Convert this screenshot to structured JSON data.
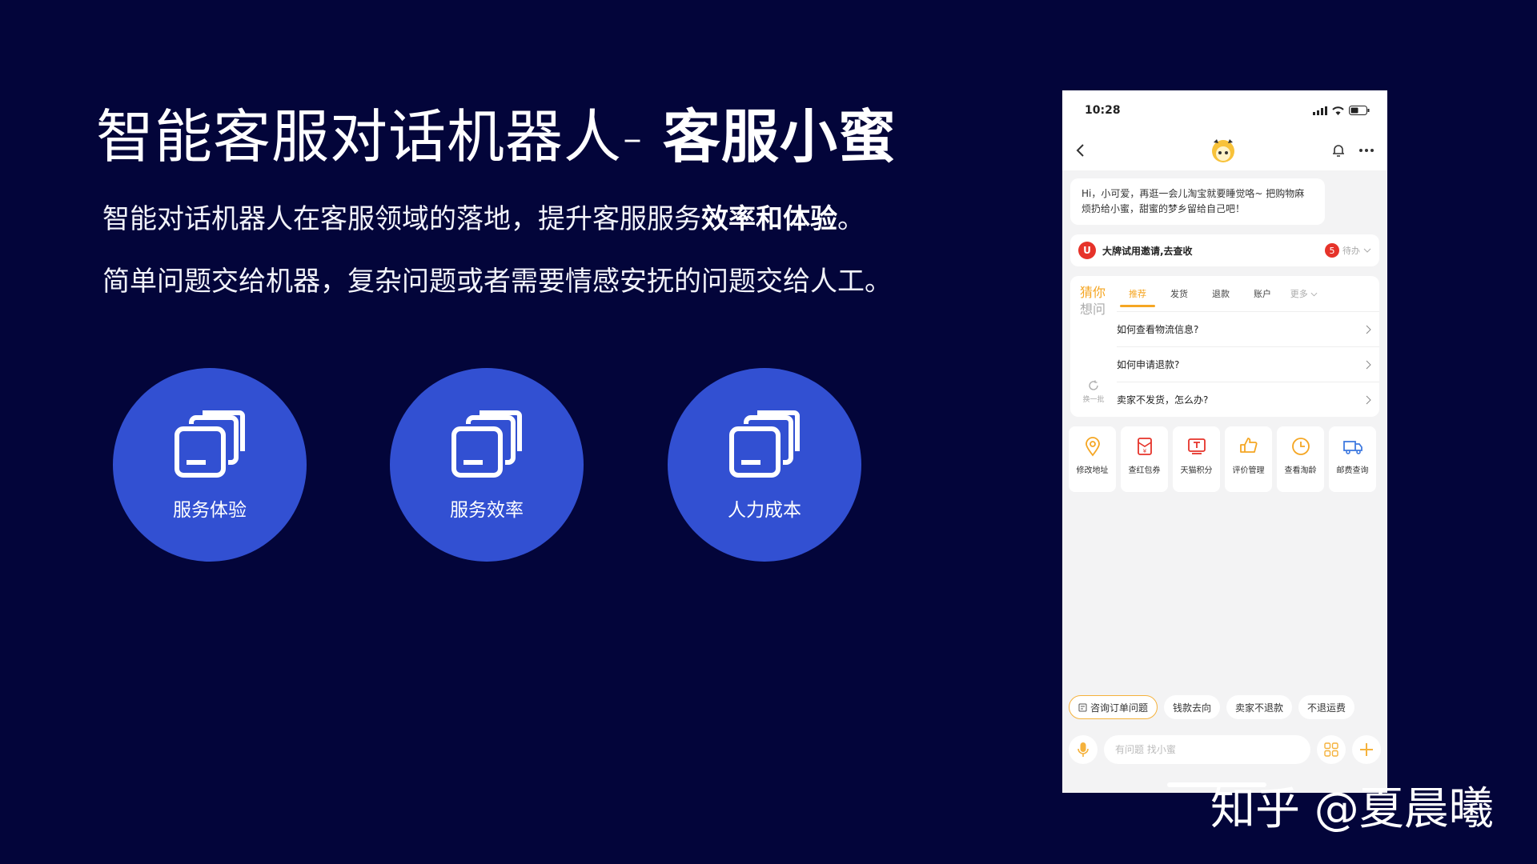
{
  "slide": {
    "title_light": "智能客服对话机器人- ",
    "title_bold": "客服小蜜",
    "line1_pre": "智能对话机器人在客服领域的落地，提升客服服务",
    "line1_bold": "效率和体验",
    "line1_post": "。",
    "line2": "简单问题交给机器，复杂问题或者需要情感安抚的问题交给人工。"
  },
  "circles": [
    {
      "label": "服务体验",
      "icon": "layers-icon"
    },
    {
      "label": "服务效率",
      "icon": "layers-icon"
    },
    {
      "label": "人力成本",
      "icon": "layers-icon"
    }
  ],
  "watermark": "知乎 @夏晨曦",
  "phone": {
    "time": "10:28",
    "greeting": "Hi，小可爱，再逛一会儿淘宝就要睡觉咯~ 把购物麻烦扔给小蜜，甜蜜的梦乡留给自己吧！",
    "invite": {
      "badge": "U",
      "text": "大牌试用邀请,去查收",
      "count": "5",
      "todo": "待办"
    },
    "guess": {
      "line1": "猜你",
      "line2": "想问",
      "refresh": "换一批"
    },
    "tabs": [
      "推荐",
      "发货",
      "退款",
      "账户",
      "更多"
    ],
    "questions": [
      "如何查看物流信息?",
      "如何申请退款?",
      "卖家不发货，怎么办?"
    ],
    "services": [
      "修改地址",
      "查红包券",
      "天猫积分",
      "评价管理",
      "查看淘龄",
      "邮费查询"
    ],
    "chips": [
      "咨询订单问题",
      "钱款去向",
      "卖家不退款",
      "不退运费"
    ],
    "input_placeholder": "有问题 找小蜜"
  },
  "colors": {
    "background": "#03053a",
    "circle": "#3250d2",
    "accent": "#f5a623",
    "badge": "#e6332a"
  }
}
